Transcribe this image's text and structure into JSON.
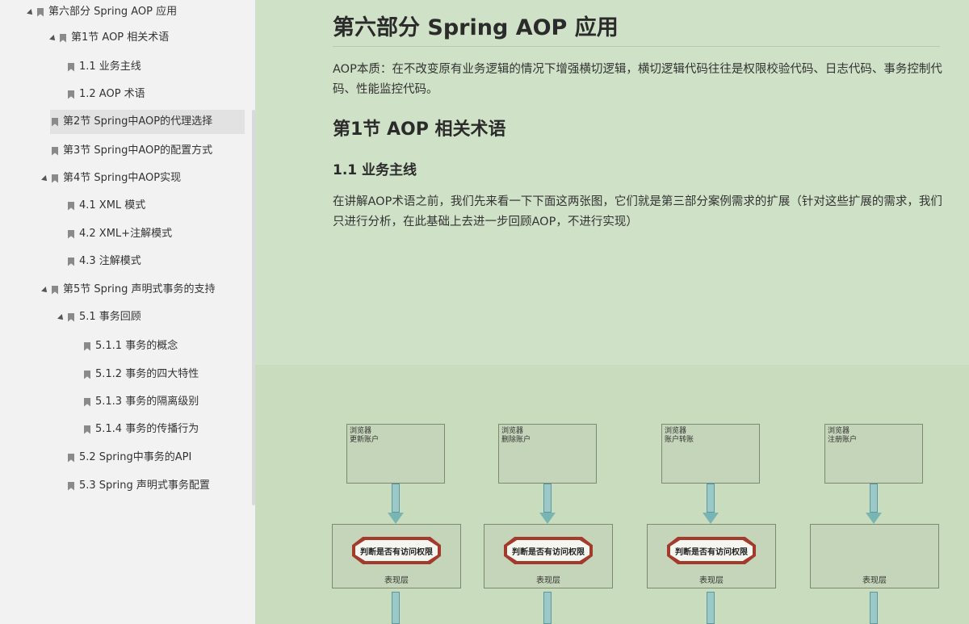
{
  "sidebar": {
    "items": [
      {
        "label": "第六部分 Spring AOP 应用",
        "expanded": true
      },
      {
        "label": "第1节 AOP 相关术语",
        "expanded": true
      },
      {
        "label": "1.1 业务主线"
      },
      {
        "label": "1.2 AOP 术语"
      },
      {
        "label": "第2节 Spring中AOP的代理选择",
        "active": true
      },
      {
        "label": "第3节 Spring中AOP的配置方式"
      },
      {
        "label": "第4节 Spring中AOP实现",
        "expanded": true
      },
      {
        "label": "4.1 XML 模式"
      },
      {
        "label": "4.2 XML+注解模式"
      },
      {
        "label": "4.3 注解模式"
      },
      {
        "label": "第5节 Spring 声明式事务的支持",
        "expanded": true
      },
      {
        "label": "5.1 事务回顾",
        "expanded": true
      },
      {
        "label": "5.1.1 事务的概念"
      },
      {
        "label": "5.1.2 事务的四大特性"
      },
      {
        "label": "5.1.3 事务的隔离级别"
      },
      {
        "label": "5.1.4 事务的传播行为"
      },
      {
        "label": "5.2 Spring中事务的API"
      },
      {
        "label": "5.3 Spring 声明式事务配置"
      }
    ]
  },
  "content": {
    "title": "第六部分 Spring AOP 应用",
    "intro": "AOP本质：在不改变原有业务逻辑的情况下增强横切逻辑，横切逻辑代码往往是权限校验代码、日志代码、事务控制代码、性能监控代码。",
    "section1": "第1节 AOP 相关术语",
    "subsection": "1.1 业务主线",
    "paragraph": "在讲解AOP术语之前，我们先来看一下下面这两张图，它们就是第三部分案例需求的扩展（针对这些扩展的需求，我们只进行分析，在此基础上去进一步回顾AOP，不进行实现）"
  },
  "diagram": {
    "columns": [
      {
        "browser": "浏览器",
        "action": "更新账户",
        "check": "判断是否有访问权限",
        "layer": "表现层"
      },
      {
        "browser": "浏览器",
        "action": "删除账户",
        "check": "判断是否有访问权限",
        "layer": "表现层"
      },
      {
        "browser": "浏览器",
        "action": "账户转账",
        "check": "判断是否有访问权限",
        "layer": "表现层"
      },
      {
        "browser": "浏览器",
        "action": "注册账户",
        "check": "",
        "layer": "表现层"
      }
    ]
  }
}
